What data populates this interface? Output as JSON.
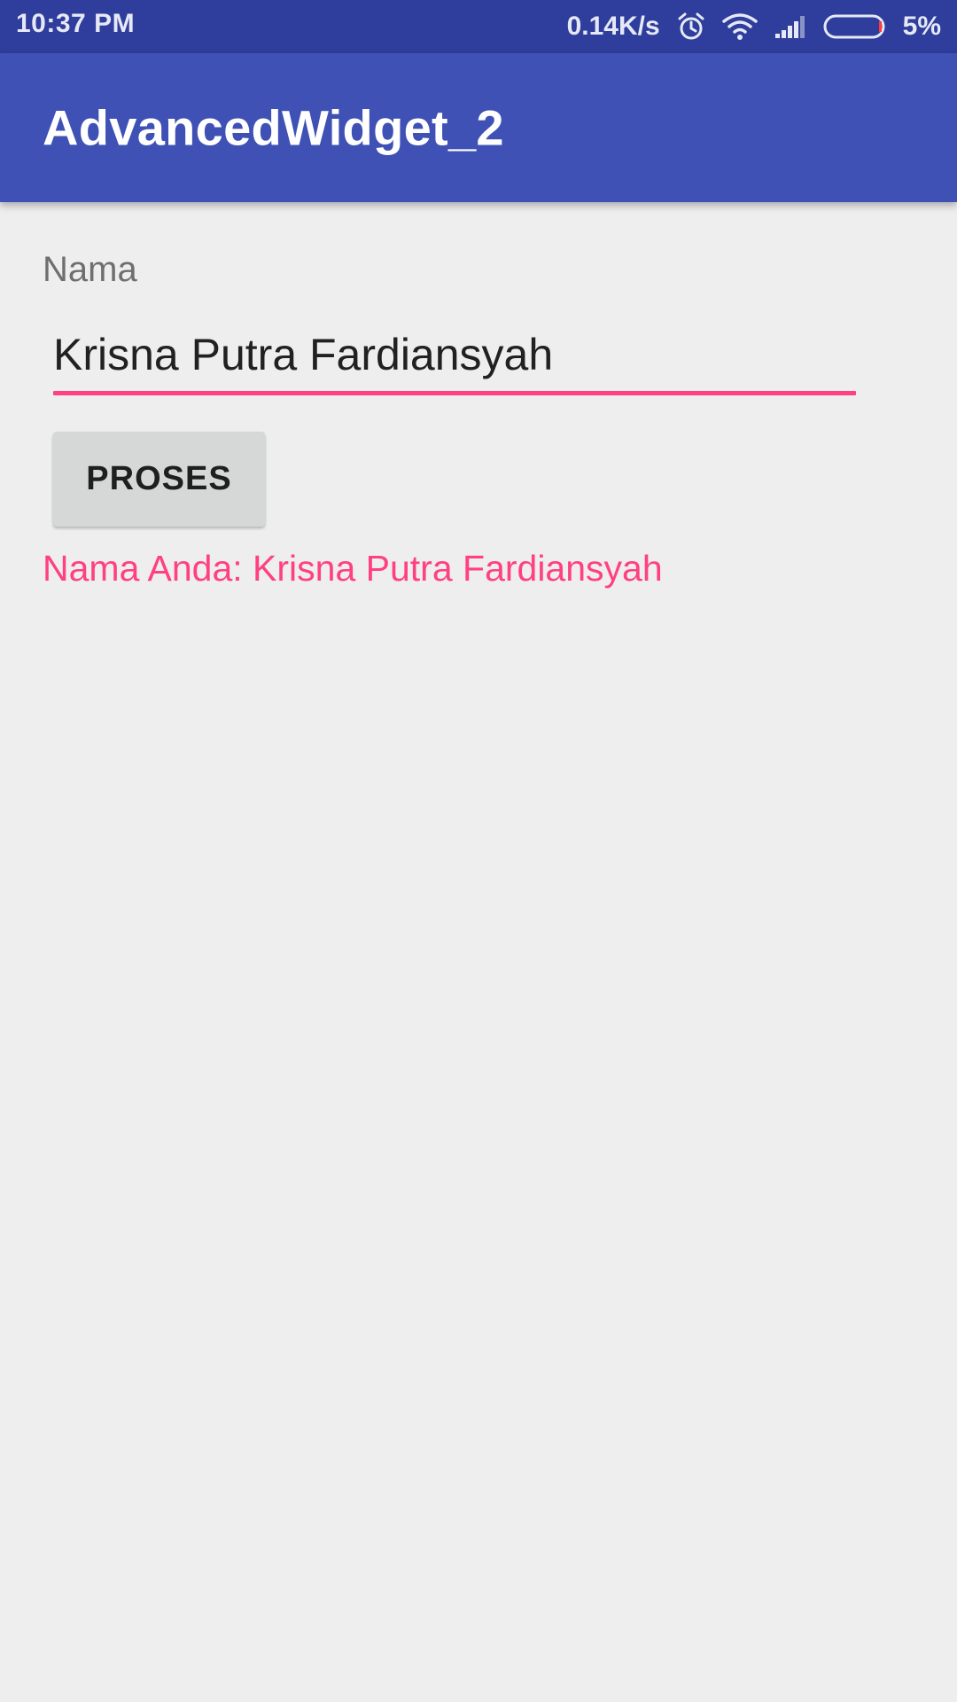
{
  "status_bar": {
    "time": "10:37 PM",
    "network_speed": "0.14K/s",
    "battery_percent": "5%",
    "battery_level": 0.05,
    "icons": [
      "alarm-icon",
      "wifi-icon",
      "signal-icon",
      "battery-icon"
    ]
  },
  "app_bar": {
    "title": "AdvancedWidget_2"
  },
  "form": {
    "label": "Nama",
    "input_value": "Krisna Putra Fardiansyah",
    "button_label": "PROSES",
    "result_text": "Nama Anda: Krisna Putra Fardiansyah"
  },
  "colors": {
    "status_bar": "#2f3d9c",
    "app_bar": "#3f51b5",
    "accent": "#ff4081",
    "background": "#eeeeee",
    "button": "#d6d7d7"
  }
}
